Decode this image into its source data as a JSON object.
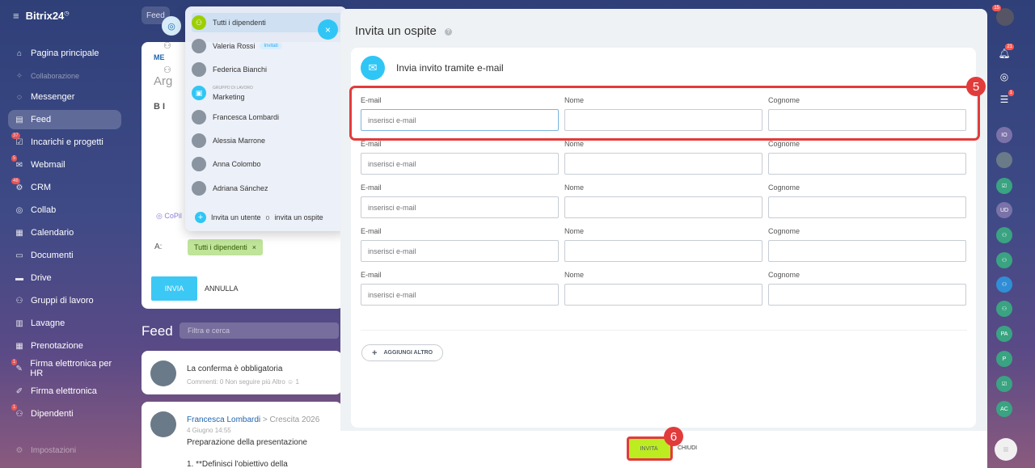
{
  "brand": "Bitrix24",
  "sidebar": {
    "items": [
      {
        "label": "Pagina principale",
        "icon": "home-icon"
      },
      {
        "label": "Collaborazione",
        "icon": "collab-icon"
      },
      {
        "label": "Messenger",
        "icon": "chat-icon"
      },
      {
        "label": "Feed",
        "icon": "feed-icon"
      },
      {
        "label": "Incarichi e progetti",
        "icon": "tasks-icon",
        "badge": "37"
      },
      {
        "label": "Webmail",
        "icon": "mail-icon",
        "badge": "5"
      },
      {
        "label": "CRM",
        "icon": "crm-icon",
        "badge": "46"
      },
      {
        "label": "Collab",
        "icon": "collab-circle-icon"
      },
      {
        "label": "Calendario",
        "icon": "calendar-icon"
      },
      {
        "label": "Documenti",
        "icon": "documents-icon"
      },
      {
        "label": "Drive",
        "icon": "drive-icon"
      },
      {
        "label": "Gruppi di lavoro",
        "icon": "groups-icon"
      },
      {
        "label": "Lavagne",
        "icon": "boards-icon"
      },
      {
        "label": "Prenotazione",
        "icon": "booking-icon"
      },
      {
        "label": "Firma elettronica per HR",
        "icon": "sign-hr-icon",
        "badge": "1"
      },
      {
        "label": "Firma elettronica",
        "icon": "sign-icon"
      },
      {
        "label": "Dipendenti",
        "icon": "employees-icon",
        "badge": "1"
      }
    ],
    "settings": "Impostazioni"
  },
  "background": {
    "top_tab": "Feed",
    "post_tab": "ME",
    "post_placeholder": "Arg",
    "format_buttons": "B  I",
    "copilot": "CoPil",
    "to_label": "A:",
    "recipient_chip": "Tutti i dipendenti",
    "send_label": "INVIA",
    "cancel_label": "ANNULLA",
    "feed_title": "Feed",
    "feed_search": "Filtra e cerca",
    "item1": {
      "title": "La conferma è obbligatoria",
      "meta": "Commenti: 0   Non seguire più   Altro   ☺ 1"
    },
    "item2": {
      "author": "Francesca Lombardi",
      "group": "  >  Crescita 2026",
      "date": "4 Giugno 14:55",
      "title": "Preparazione della presentazione",
      "body": "1. **Definisci l'obiettivo della presentazione**"
    }
  },
  "dropdown": {
    "items": [
      {
        "label": "Tutti i dipendenti",
        "type": "all"
      },
      {
        "label": "Valeria Rossi",
        "tag": "Invitati"
      },
      {
        "label": "Federica Bianchi"
      },
      {
        "label": "Marketing",
        "small": "GRUPPO DI LAVORO",
        "type": "group"
      },
      {
        "label": "Francesca Lombardi"
      },
      {
        "label": "Alessia Marrone"
      },
      {
        "label": "Anna Colombo"
      },
      {
        "label": "Adriana Sánchez"
      }
    ],
    "footer": {
      "invite_user": "Invita un utente",
      "or": "o",
      "invite_guest": "invita un ospite"
    }
  },
  "modal": {
    "title": "Invita un ospite",
    "panel_title": "Invia invito tramite e-mail",
    "labels": {
      "email": "E-mail",
      "first_name": "Nome",
      "last_name": "Cognome"
    },
    "email_placeholder": "inserisci e-mail",
    "rows": 5,
    "add_more": "AGGIUNGI ALTRO",
    "invite_btn": "INVITA",
    "close_btn": "CHIUDI"
  },
  "annotations": {
    "step5": "5",
    "step6": "6"
  },
  "right_sidebar": {
    "badges": {
      "notifications": "21",
      "chat": "1",
      "top": "15"
    },
    "avatars": [
      "IO",
      "UD",
      "PA",
      "P",
      "AC"
    ]
  },
  "colors": {
    "accent": "#2fc6f6",
    "invite_btn": "#bbed21",
    "highlight": "#e23b3b"
  }
}
